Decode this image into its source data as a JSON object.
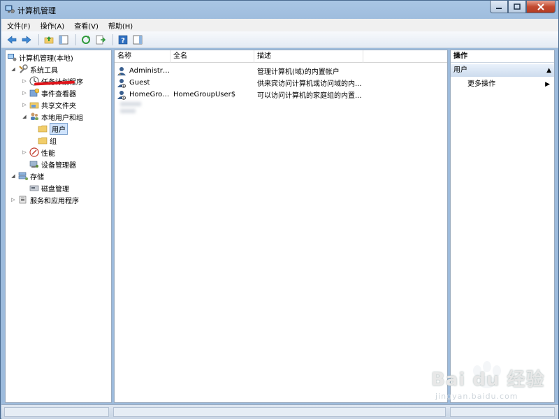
{
  "window": {
    "title": "计算机管理"
  },
  "menu": [
    "文件(F)",
    "操作(A)",
    "查看(V)",
    "帮助(H)"
  ],
  "tree": {
    "root": "计算机管理(本地)",
    "system_tools": "系统工具",
    "task_scheduler": "任务计划程序",
    "event_viewer": "事件查看器",
    "shared_folders": "共享文件夹",
    "local_users_groups": "本地用户和组",
    "users": "用户",
    "groups": "组",
    "performance": "性能",
    "device_manager": "设备管理器",
    "storage": "存储",
    "disk_management": "磁盘管理",
    "services_apps": "服务和应用程序"
  },
  "list": {
    "columns": [
      "名称",
      "全名",
      "描述"
    ],
    "rows": [
      {
        "name": "Administrat...",
        "fullname": "",
        "description": "管理计算机(域)的内置帐户"
      },
      {
        "name": "Guest",
        "fullname": "",
        "description": "供来宾访问计算机或访问域的内..."
      },
      {
        "name": "HomeGrou...",
        "fullname": "HomeGroupUser$",
        "description": "可以访问计算机的家庭组的内置..."
      }
    ]
  },
  "actions": {
    "header": "操作",
    "section": "用户",
    "more": "更多操作"
  },
  "watermark": {
    "brand": "Bai du 经验",
    "url": "jingyan.baidu.com"
  },
  "colors": {
    "selection": "#cfe3fc",
    "annotation": "#e0141a",
    "close_button": "#c24b31"
  }
}
